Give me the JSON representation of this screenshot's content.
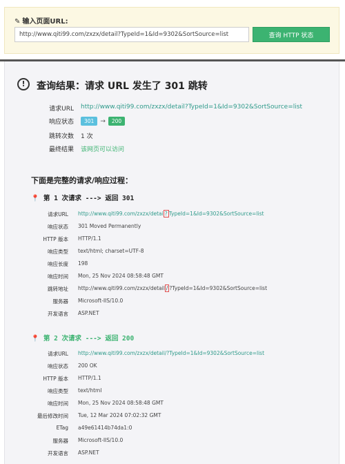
{
  "input_section": {
    "label": "输入页面URL:",
    "url_value": "http://www.qiti99.com/zxzx/detail?TypeId=1&Id=9302&SortSource=list",
    "button_label": "查询 HTTP 状态"
  },
  "result": {
    "icon_glyph": "!",
    "title": "查询结果：请求 URL 发生了 301 跳转",
    "summary": {
      "request_url_label": "请求URL",
      "request_url": "http://www.qiti99.com/zxzx/detail?TypeId=1&Id=9302&SortSource=list",
      "status_label": "响应状态",
      "status_from": "301",
      "status_arrow": "→",
      "status_to": "200",
      "redirect_count_label": "跳转次数",
      "redirect_count": "1 次",
      "final_label": "最终结果",
      "final_value": "该网页可以访问"
    },
    "process_title": "下面是完整的请求/响应过程：",
    "requests": [
      {
        "title_prefix": "第 1 次请求 ---> ",
        "title_suffix": "返回 301",
        "details": {
          "req_url_label": "请求URL",
          "req_url_a": "http://www.qiti99.com/zxzx/detai",
          "req_url_b": "?",
          "req_url_c": "TypeId=1&Id=9302&SortSource=list",
          "status_label": "响应状态",
          "status": "301 Moved Permanently",
          "http_version_label": "HTTP 版本",
          "http_version": "HTTP/1.1",
          "content_type_label": "响应类型",
          "content_type": "text/html; charset=UTF-8",
          "content_length_label": "响应长度",
          "content_length": "198",
          "date_label": "响应时间",
          "date": "Mon, 25 Nov 2024 08:58:48 GMT",
          "location_label": "跳转地址",
          "location_a": "http://www.qiti99.com/zxzx/detail",
          "location_b": "/",
          "location_c": "?TypeId=1&Id=9302&SortSource=list",
          "server_label": "服务器",
          "server": "Microsoft-IIS/10.0",
          "lang_label": "开发语言",
          "lang": "ASP.NET"
        }
      },
      {
        "title_prefix": "第 2 次请求 ---> ",
        "title_suffix": "返回 200",
        "details": {
          "req_url_label": "请求URL",
          "req_url": "http://www.qiti99.com/zxzx/detail/?TypeId=1&Id=9302&SortSource=list",
          "status_label": "响应状态",
          "status": "200 OK",
          "http_version_label": "HTTP 版本",
          "http_version": "HTTP/1.1",
          "content_type_label": "响应类型",
          "content_type": "text/html",
          "date_label": "响应时间",
          "date": "Mon, 25 Nov 2024 08:58:48 GMT",
          "last_modified_label": "最后修改时间",
          "last_modified": "Tue, 12 Mar 2024 07:02:32 GMT",
          "etag_label": "ETag",
          "etag": "a49e61414b74da1:0",
          "server_label": "服务器",
          "server": "Microsoft-IIS/10.0",
          "lang_label": "开发语言",
          "lang": "ASP.NET"
        }
      }
    ]
  },
  "colors": {
    "top_bg": "#fcf8e3",
    "button": "#3cb371",
    "link": "#2e9a8a",
    "badge_301": "#5bc0de",
    "badge_200": "#3cb371"
  }
}
